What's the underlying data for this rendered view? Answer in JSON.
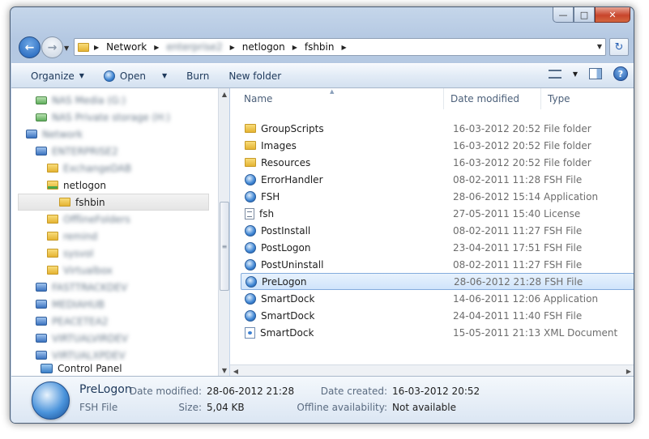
{
  "window": {
    "min": "0",
    "max": "1",
    "close": "r"
  },
  "nav": {
    "back": "←",
    "forward": "→"
  },
  "breadcrumb": [
    {
      "label": "Network",
      "blurred": false
    },
    {
      "label": "enterprise2",
      "blurred": true
    },
    {
      "label": "netlogon",
      "blurred": false
    },
    {
      "label": "fshbin",
      "blurred": false
    }
  ],
  "toolbar": {
    "organize": "Organize",
    "open": "Open",
    "burn": "Burn",
    "new_folder": "New folder"
  },
  "nav_pane": {
    "items": [
      {
        "label": "NAS Media (G:)",
        "blurred": true,
        "icon": "green",
        "indent": 30
      },
      {
        "label": "NAS Private storage (H:)",
        "blurred": true,
        "icon": "green",
        "indent": 30
      },
      {
        "label": "Network",
        "blurred": true,
        "icon": "blue",
        "indent": 18
      },
      {
        "label": "ENTERPRISE2",
        "blurred": true,
        "icon": "blue",
        "indent": 30
      },
      {
        "label": "ExchangeDAB",
        "blurred": true,
        "icon": "folder",
        "indent": 44
      },
      {
        "label": "netlogon",
        "blurred": false,
        "icon": "netfolder",
        "indent": 44
      },
      {
        "label": "fshbin",
        "blurred": false,
        "icon": "folder",
        "indent": 58,
        "selected": true
      },
      {
        "label": "OfflineFolders",
        "blurred": true,
        "icon": "folder",
        "indent": 44
      },
      {
        "label": "remind",
        "blurred": true,
        "icon": "folder",
        "indent": 44
      },
      {
        "label": "sysvol",
        "blurred": true,
        "icon": "folder",
        "indent": 44
      },
      {
        "label": "Virtualbox",
        "blurred": true,
        "icon": "folder",
        "indent": 44
      },
      {
        "label": "FASTTRACKDEV",
        "blurred": true,
        "icon": "blue",
        "indent": 30
      },
      {
        "label": "MEDIAHUB",
        "blurred": true,
        "icon": "blue",
        "indent": 30
      },
      {
        "label": "PEACETEA2",
        "blurred": true,
        "icon": "blue",
        "indent": 30
      },
      {
        "label": "VIRTUALVIRDEV",
        "blurred": true,
        "icon": "blue",
        "indent": 30
      },
      {
        "label": "VIRTUALXPDEV",
        "blurred": true,
        "icon": "blue",
        "indent": 30
      }
    ],
    "control_panel": "Control Panel"
  },
  "columns": {
    "name": "Name",
    "date": "Date modified",
    "type": "Type"
  },
  "files": [
    {
      "name": "GroupScripts",
      "date": "16-03-2012 20:52",
      "type": "File folder",
      "icon": "folder"
    },
    {
      "name": "Images",
      "date": "16-03-2012 20:52",
      "type": "File folder",
      "icon": "folder"
    },
    {
      "name": "Resources",
      "date": "16-03-2012 20:52",
      "type": "File folder",
      "icon": "folder"
    },
    {
      "name": "ErrorHandler",
      "date": "08-02-2011 11:28",
      "type": "FSH File",
      "icon": "fsh"
    },
    {
      "name": "FSH",
      "date": "28-06-2012 15:14",
      "type": "Application",
      "icon": "fsh"
    },
    {
      "name": "fsh",
      "date": "27-05-2011 15:40",
      "type": "License",
      "icon": "doc"
    },
    {
      "name": "PostInstall",
      "date": "08-02-2011 11:27",
      "type": "FSH File",
      "icon": "fsh"
    },
    {
      "name": "PostLogon",
      "date": "23-04-2011 17:51",
      "type": "FSH File",
      "icon": "fsh"
    },
    {
      "name": "PostUninstall",
      "date": "08-02-2011 11:27",
      "type": "FSH File",
      "icon": "fsh"
    },
    {
      "name": "PreLogon",
      "date": "28-06-2012 21:28",
      "type": "FSH File",
      "icon": "fsh",
      "selected": true
    },
    {
      "name": "SmartDock",
      "date": "14-06-2011 12:06",
      "type": "Application",
      "icon": "fsh"
    },
    {
      "name": "SmartDock",
      "date": "24-04-2011 11:40",
      "type": "FSH File",
      "icon": "fsh"
    },
    {
      "name": "SmartDock",
      "date": "15-05-2011 21:13",
      "type": "XML Document",
      "icon": "xml"
    }
  ],
  "details": {
    "name": "PreLogon",
    "kind": "FSH File",
    "date_modified_label": "Date modified:",
    "date_modified": "28-06-2012 21:28",
    "size_label": "Size:",
    "size": "5,04 KB",
    "date_created_label": "Date created:",
    "date_created": "16-03-2012 20:52",
    "offline_label": "Offline availability:",
    "offline": "Not available"
  }
}
